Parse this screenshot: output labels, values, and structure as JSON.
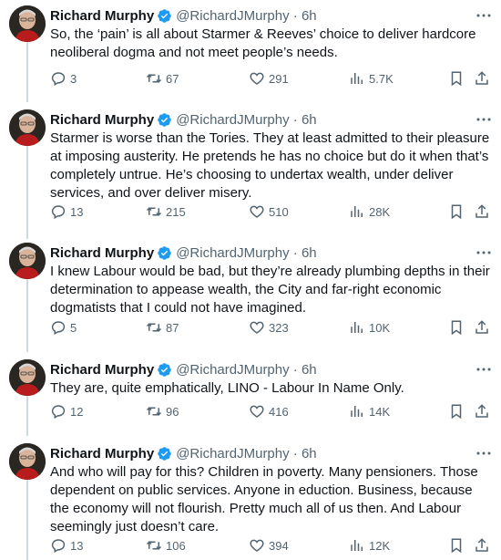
{
  "tweets": [
    {
      "author": "Richard Murphy",
      "handle": "@RichardJMurphy",
      "time": "6h",
      "text": "So, the ‘pain’ is all about Starmer & Reeves’ choice to deliver hardcore neoliberal dogma and not meet people’s  needs.",
      "replies": "3",
      "retweets": "67",
      "likes": "291",
      "views": "5.7K"
    },
    {
      "author": "Richard Murphy",
      "handle": "@RichardJMurphy",
      "time": "6h",
      "text": "Starmer is worse than the Tories. They at least admitted to their pleasure at imposing austerity. He pretends he has no choice but do it when that’s completely untrue. He’s choosing to undertax wealth, under deliver services, and over deliver misery.",
      "replies": "13",
      "retweets": "215",
      "likes": "510",
      "views": "28K"
    },
    {
      "author": "Richard Murphy",
      "handle": "@RichardJMurphy",
      "time": "6h",
      "text": "I knew Labour would be bad, but they’re already plumbing depths in their determination to appease wealth, the City and far-right economic dogmatists that I could not have imagined.",
      "replies": "5",
      "retweets": "87",
      "likes": "323",
      "views": "10K"
    },
    {
      "author": "Richard Murphy",
      "handle": "@RichardJMurphy",
      "time": "6h",
      "text": "They are, quite emphatically, LINO - Labour In Name Only.",
      "replies": "12",
      "retweets": "96",
      "likes": "416",
      "views": "14K"
    },
    {
      "author": "Richard Murphy",
      "handle": "@RichardJMurphy",
      "time": "6h",
      "text": "And who will pay for this? Children in poverty. Many pensioners. Those dependent on public services. Anyone in eduction. Business, because the economy will not flourish. Pretty much all of us then. And Labour seemingly just doesn’t care.",
      "replies": "13",
      "retweets": "106",
      "likes": "394",
      "views": "12K"
    }
  ],
  "icons": {
    "verified": "verified-badge-icon",
    "more": "more-icon",
    "reply": "reply-icon",
    "retweet": "retweet-icon",
    "like": "heart-icon",
    "views": "views-icon",
    "bookmark": "bookmark-icon",
    "share": "share-icon"
  },
  "colors": {
    "verified": "#1d9bf0",
    "text": "#0f1419",
    "muted": "#536471",
    "thread_line": "#cfd9de"
  }
}
